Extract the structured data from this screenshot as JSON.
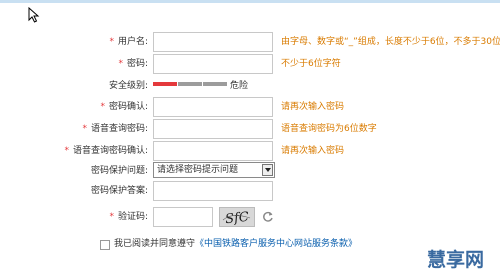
{
  "form": {
    "username": {
      "label": "用户名:",
      "required": true,
      "value": "",
      "hint": "由字母、数字或“_”组成，长度不少于6位，不多于30位"
    },
    "password": {
      "label": "密码:",
      "required": true,
      "value": "",
      "hint": "不少于6位字符"
    },
    "security_level": {
      "label": "安全级别:",
      "level_text": "危险",
      "filled_segments": 1,
      "total_segments": 3,
      "colors": [
        "#e4393c",
        "#9c9c9c",
        "#9c9c9c"
      ]
    },
    "confirm_password": {
      "label": "密码确认:",
      "required": true,
      "value": "",
      "hint": "请再次输入密码"
    },
    "query_password": {
      "label": "语音查询密码:",
      "required": true,
      "value": "",
      "hint": "语音查询密码为6位数字"
    },
    "confirm_query_password": {
      "label": "语音查询密码确认:",
      "required": true,
      "value": "",
      "hint": "请再次输入密码"
    },
    "security_question": {
      "label": "密码保护问题:",
      "selected": "请选择密码提示问题"
    },
    "security_answer": {
      "label": "密码保护答案:",
      "value": ""
    },
    "captcha": {
      "label": "验证码:",
      "required": true,
      "value": "",
      "image_text": "SfC"
    }
  },
  "agreement": {
    "text": "我已阅读并同意遵守",
    "link": "《中国铁路客户服务中心网站服务条款》",
    "checked": false
  },
  "watermark": "慧享网",
  "icons": [
    "cursor-icon",
    "refresh-icon",
    "dropdown-arrow-icon"
  ],
  "colors": {
    "required": "#e4393c",
    "hint": "#d97b00",
    "link": "#0a5fae"
  }
}
